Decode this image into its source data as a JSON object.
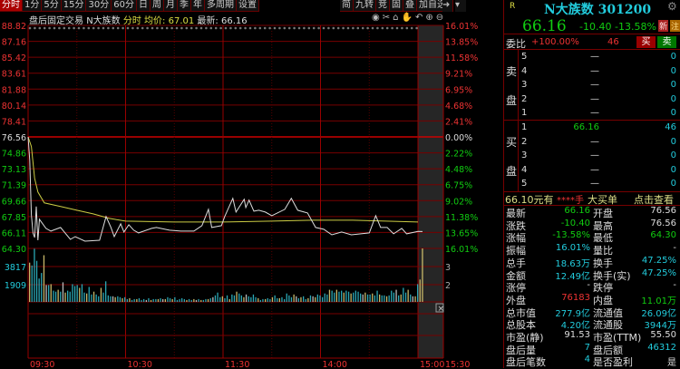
{
  "tabs": [
    "分时",
    "1分",
    "5分",
    "15分",
    "30分",
    "60分",
    "日",
    "周",
    "月",
    "季",
    "年",
    "多周期",
    "设置"
  ],
  "tools": [
    "简",
    "九转",
    "竞",
    "固",
    "叠",
    "加自选"
  ],
  "toolbar_icons": [
    "eye-icon",
    "scissors-icon",
    "lock-icon",
    "hand-icon",
    "undo-icon",
    "zoom-in-icon",
    "zoom-out-icon"
  ],
  "chart_header": {
    "mode": "盘后固定交易",
    "name": "N大族数",
    "type": "分时",
    "avg_label": "均价: 67.01",
    "last_label": "最新: 66.16"
  },
  "chart_data": {
    "type": "line",
    "prev_close": 76.56,
    "price_ticks": [
      "88.82",
      "87.16",
      "85.42",
      "83.61",
      "81.88",
      "80.14",
      "78.41",
      "76.56",
      "74.86",
      "73.13",
      "71.39",
      "69.66",
      "67.85",
      "66.11",
      "64.30"
    ],
    "pct_ticks": [
      "16.01%",
      "13.85%",
      "11.58%",
      "9.21%",
      "6.95%",
      "4.68%",
      "2.41%",
      "0.00%",
      "2.22%",
      "4.48%",
      "6.75%",
      "9.02%",
      "11.38%",
      "13.65%",
      "16.01%"
    ],
    "ylim": [
      64.3,
      88.82
    ],
    "time_ticks": [
      "09:30",
      "10:30",
      "11:30",
      "14:00",
      "15:00",
      "15:30"
    ],
    "price": [
      [
        0,
        76.56
      ],
      [
        1,
        74
      ],
      [
        2,
        68
      ],
      [
        3,
        66
      ],
      [
        4,
        65.5
      ],
      [
        5,
        68.9
      ],
      [
        6,
        65.2
      ],
      [
        7,
        67.5
      ],
      [
        11,
        66.5
      ],
      [
        14,
        66.2
      ],
      [
        20,
        66.6
      ],
      [
        26,
        65.3
      ],
      [
        29,
        65.6
      ],
      [
        35,
        65.1
      ],
      [
        44,
        65.2
      ],
      [
        48,
        67.8
      ],
      [
        51,
        66.6
      ],
      [
        53,
        65.6
      ],
      [
        57,
        67
      ],
      [
        59,
        66.1
      ],
      [
        62,
        66.9
      ],
      [
        65,
        66.3
      ],
      [
        68,
        66
      ],
      [
        76,
        66.5
      ],
      [
        79,
        66.6
      ],
      [
        87,
        66.3
      ],
      [
        94,
        66.2
      ],
      [
        102,
        66.2
      ],
      [
        107,
        66.8
      ],
      [
        111,
        68.6
      ],
      [
        113,
        66.6
      ],
      [
        119,
        66.8
      ],
      [
        121,
        67.8
      ],
      [
        126,
        69.8
      ],
      [
        128,
        68.3
      ],
      [
        133,
        69.7
      ],
      [
        134,
        68.8
      ],
      [
        136,
        69.6
      ],
      [
        139,
        68.4
      ],
      [
        142,
        68.5
      ],
      [
        146,
        68.3
      ],
      [
        150,
        67.9
      ],
      [
        158,
        68.6
      ],
      [
        162,
        69.8
      ],
      [
        166,
        68.5
      ],
      [
        172,
        68.2
      ],
      [
        177,
        66.6
      ],
      [
        182,
        66.4
      ],
      [
        187,
        65.8
      ],
      [
        193,
        66.1
      ],
      [
        199,
        65.8
      ],
      [
        210,
        66
      ],
      [
        214,
        67.9
      ],
      [
        217,
        66.6
      ],
      [
        221,
        66.6
      ],
      [
        225,
        65.9
      ],
      [
        230,
        66.5
      ],
      [
        233,
        65.9
      ],
      [
        240,
        66.16
      ]
    ],
    "avg": [
      [
        0,
        76.56
      ],
      [
        2,
        75.5
      ],
      [
        4,
        72
      ],
      [
        6,
        70.5
      ],
      [
        10,
        69.3
      ],
      [
        20,
        68.9
      ],
      [
        30,
        68.5
      ],
      [
        40,
        68.1
      ],
      [
        50,
        67.6
      ],
      [
        60,
        67.3
      ],
      [
        90,
        67.2
      ],
      [
        120,
        67.2
      ],
      [
        150,
        67.3
      ],
      [
        175,
        67.4
      ],
      [
        200,
        67.4
      ],
      [
        240,
        67.2
      ]
    ],
    "volume_ticks": [
      "3817",
      "1909"
    ],
    "volume_right_ticks": [
      "3",
      "2"
    ],
    "volume_max": 5725,
    "volume": [
      4200,
      3900,
      5700,
      4400,
      2500,
      3100,
      5000,
      1800,
      1800,
      1900,
      1200,
      1100,
      1300,
      1100,
      2100,
      1000,
      1200,
      1100,
      1900,
      1700,
      1800,
      1500,
      1900,
      1000,
      900,
      1600,
      800,
      1100,
      800,
      600,
      1500,
      1000,
      2200,
      700,
      600,
      600,
      500,
      600,
      500,
      400,
      500,
      300,
      400,
      200,
      300,
      300,
      400,
      200,
      300,
      200,
      400,
      200,
      300,
      300,
      300,
      400,
      300,
      300,
      500,
      400,
      300,
      500,
      200,
      300,
      400,
      300,
      200,
      300,
      200,
      300,
      200,
      300,
      200,
      200,
      300,
      300,
      400,
      500,
      700,
      1000,
      500,
      600,
      400,
      700,
      300,
      800,
      700,
      1100,
      900,
      700,
      500,
      800,
      600,
      500,
      800,
      500,
      400,
      200,
      300,
      300,
      400,
      300,
      500,
      700,
      400,
      400,
      500,
      300,
      900,
      700,
      500,
      800,
      600,
      400,
      500,
      600,
      300,
      400,
      700,
      600,
      500,
      800,
      700,
      500,
      900,
      800,
      1300,
      1200,
      1000,
      1300,
      1100,
      1200,
      1000,
      1200,
      1100,
      900,
      1000,
      1200,
      1100,
      900,
      800,
      1000,
      800,
      800,
      900,
      700,
      1200,
      800,
      700,
      700,
      600,
      700,
      1200,
      1000,
      1300,
      700,
      800,
      1500,
      1000,
      1300,
      800,
      600,
      600,
      1900,
      2400,
      6000
    ],
    "volume_colors": {
      "up": "#c8b86a",
      "down": "#2aa7b5",
      "flat": "#bbb"
    }
  },
  "quote": {
    "badge": "R",
    "title": "N大族数 301200",
    "price": "66.16",
    "change": "-10.40",
    "pct": "-13.58%",
    "tag_new": "新",
    "tag_note": "注",
    "wb_label": "委比",
    "wb_value": "+100.00%",
    "wc_value": "46",
    "buy_btn": "买",
    "sell_btn": "卖",
    "sell_label": [
      "卖",
      "盘"
    ],
    "buy_label": [
      "买",
      "盘"
    ],
    "asks": [
      {
        "lv": "5",
        "p": "—",
        "v": "0"
      },
      {
        "lv": "4",
        "p": "—",
        "v": "0"
      },
      {
        "lv": "3",
        "p": "—",
        "v": "0"
      },
      {
        "lv": "2",
        "p": "—",
        "v": "0"
      },
      {
        "lv": "1",
        "p": "—",
        "v": "0"
      }
    ],
    "bids": [
      {
        "lv": "1",
        "p": "66.16",
        "v": "46"
      },
      {
        "lv": "2",
        "p": "—",
        "v": "0"
      },
      {
        "lv": "3",
        "p": "—",
        "v": "0"
      },
      {
        "lv": "4",
        "p": "—",
        "v": "0"
      },
      {
        "lv": "5",
        "p": "—",
        "v": "0"
      }
    ],
    "big_order": {
      "a": "66.10元有",
      "b": "****手",
      "c": "大买单",
      "link": "点击查看"
    },
    "stats": [
      [
        "最新",
        "66.16",
        "green",
        "开盘",
        "76.56",
        "white"
      ],
      [
        "涨跌",
        "-10.40",
        "green",
        "最高",
        "76.56",
        "white"
      ],
      [
        "涨幅",
        "-13.58%",
        "green",
        "最低",
        "64.30",
        "green"
      ],
      [
        "振幅",
        "16.01%",
        "cyan",
        "量比",
        "-",
        "white"
      ],
      [
        "总手",
        "18.63万",
        "cyan",
        "换手",
        "47.25%",
        "cyan"
      ],
      [
        "金额",
        "12.49亿",
        "cyan",
        "换手(实)",
        "47.25%",
        "cyan"
      ],
      [
        "涨停",
        "-",
        "white",
        "跌停",
        "-",
        "white"
      ],
      [
        "外盘",
        "76183",
        "red",
        "内盘",
        "11.01万",
        "green"
      ],
      [
        "总市值",
        "277.9亿",
        "cyan",
        "流通值",
        "26.09亿",
        "cyan"
      ],
      [
        "总股本",
        "4.20亿",
        "cyan",
        "流通股",
        "3944万",
        "cyan"
      ],
      [
        "市盈(静)",
        "91.53",
        "white",
        "市盈(TTM)",
        "55.50",
        "white"
      ],
      [
        "盘后量",
        "7",
        "cyan",
        "盘后额",
        "46312",
        "cyan"
      ],
      [
        "盘后笔数",
        "4",
        "cyan",
        "是否盈利",
        "是",
        "white"
      ]
    ]
  }
}
